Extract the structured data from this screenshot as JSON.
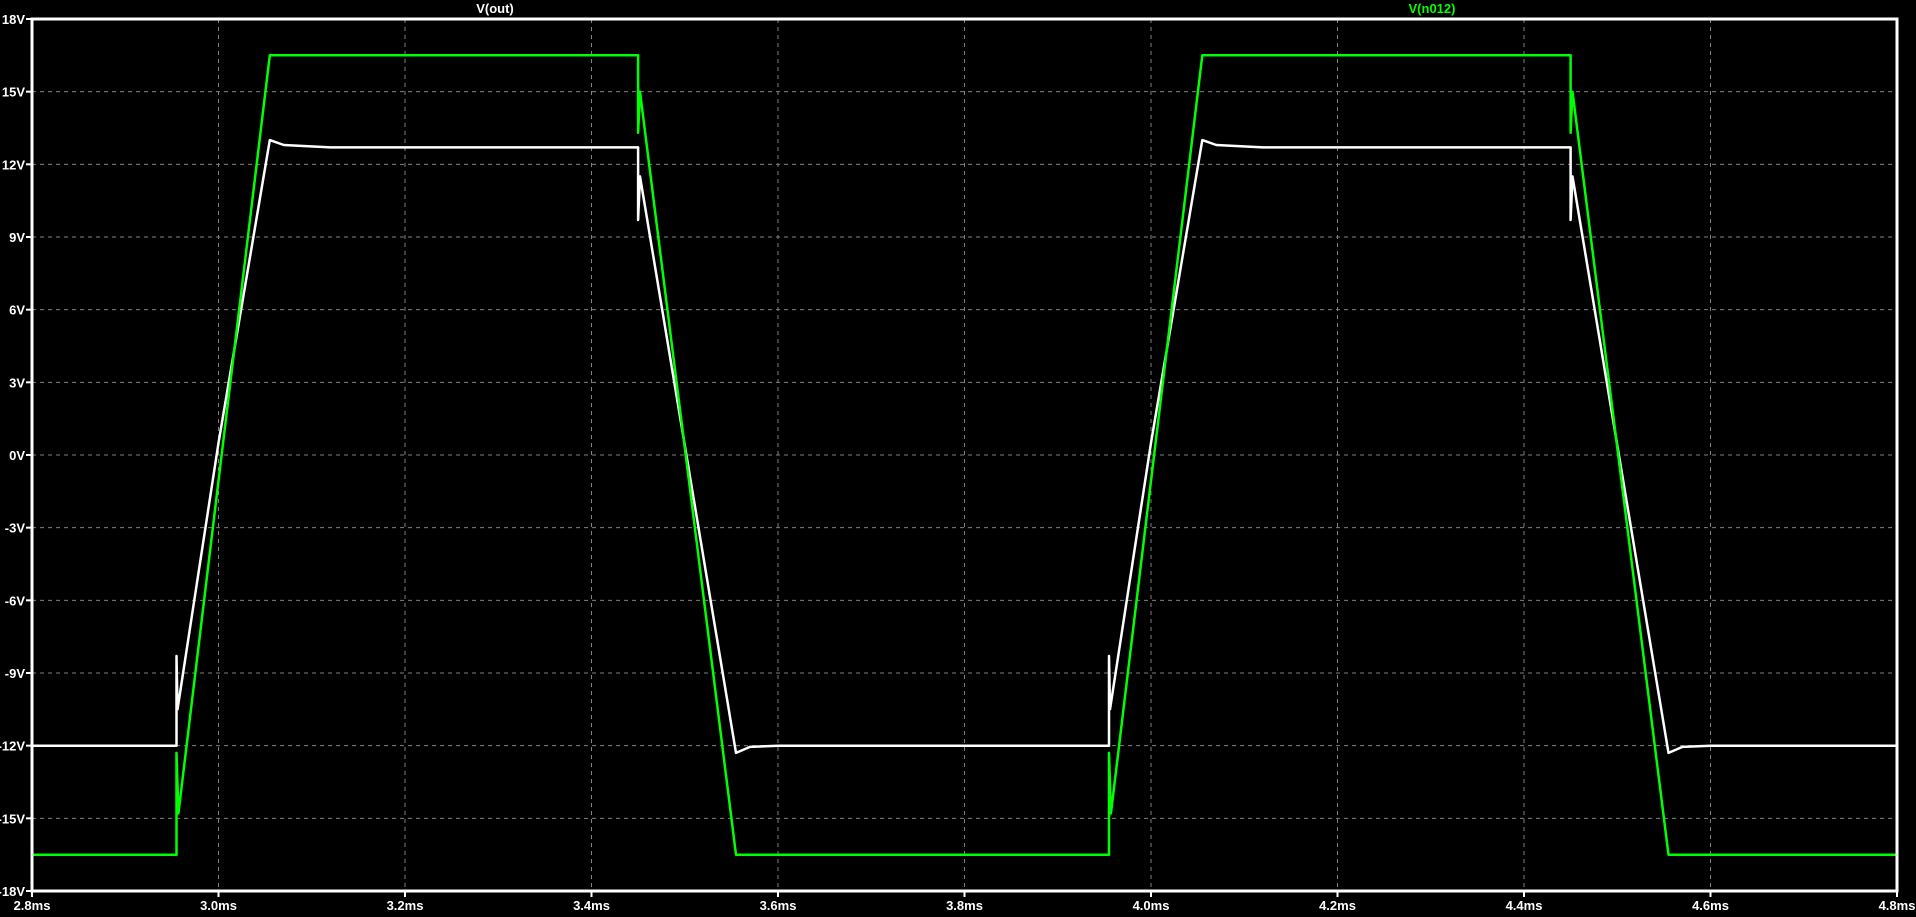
{
  "chart_data": {
    "type": "line",
    "title": "",
    "xlabel": "",
    "ylabel": "",
    "xlim": [
      2.8,
      4.8
    ],
    "ylim": [
      -18,
      18
    ],
    "grid": true,
    "background": "#000000",
    "x_ticks": [
      2.8,
      3.0,
      3.2,
      3.4,
      3.6,
      3.8,
      4.0,
      4.2,
      4.4,
      4.6,
      4.8
    ],
    "x_tick_labels": [
      "2.8ms",
      "3.0ms",
      "3.2ms",
      "3.4ms",
      "3.6ms",
      "3.8ms",
      "4.0ms",
      "4.2ms",
      "4.4ms",
      "4.6ms",
      "4.8ms"
    ],
    "y_ticks": [
      18,
      15,
      12,
      9,
      6,
      3,
      0,
      -3,
      -6,
      -9,
      -12,
      -15,
      -18
    ],
    "y_tick_labels": [
      "18V",
      "15V",
      "12V",
      "9V",
      "6V",
      "3V",
      "0V",
      "-3V",
      "-6V",
      "-9V",
      "-12V",
      "-15V",
      "-18V"
    ],
    "legend_placement": "top",
    "series": [
      {
        "name": "V(out)",
        "color": "#ffffff",
        "points": [
          [
            2.8,
            -12
          ],
          [
            2.955,
            -12
          ],
          [
            2.955,
            -8.3
          ],
          [
            2.956,
            -10.5
          ],
          [
            3.0,
            0.5
          ],
          [
            3.055,
            13.0
          ],
          [
            3.07,
            12.8
          ],
          [
            3.12,
            12.7
          ],
          [
            3.45,
            12.7
          ],
          [
            3.45,
            9.7
          ],
          [
            3.452,
            11.5
          ],
          [
            3.555,
            -12.3
          ],
          [
            3.57,
            -12.05
          ],
          [
            3.6,
            -12
          ],
          [
            3.955,
            -12
          ],
          [
            3.955,
            -8.3
          ],
          [
            3.956,
            -10.5
          ],
          [
            4.0,
            0.5
          ],
          [
            4.055,
            13.0
          ],
          [
            4.07,
            12.8
          ],
          [
            4.12,
            12.7
          ],
          [
            4.45,
            12.7
          ],
          [
            4.45,
            9.7
          ],
          [
            4.452,
            11.5
          ],
          [
            4.555,
            -12.3
          ],
          [
            4.57,
            -12.05
          ],
          [
            4.6,
            -12
          ],
          [
            4.8,
            -12
          ]
        ]
      },
      {
        "name": "V(n012)",
        "color": "#00ff00",
        "points": [
          [
            2.8,
            -16.5
          ],
          [
            2.955,
            -16.5
          ],
          [
            2.955,
            -12.3
          ],
          [
            2.957,
            -14.8
          ],
          [
            3.055,
            16.5
          ],
          [
            3.45,
            16.5
          ],
          [
            3.45,
            13.3
          ],
          [
            3.452,
            15.0
          ],
          [
            3.555,
            -16.5
          ],
          [
            3.955,
            -16.5
          ],
          [
            3.955,
            -12.3
          ],
          [
            3.957,
            -14.8
          ],
          [
            4.055,
            16.5
          ],
          [
            4.45,
            16.5
          ],
          [
            4.45,
            13.3
          ],
          [
            4.452,
            15.0
          ],
          [
            4.555,
            -16.5
          ],
          [
            4.8,
            -16.5
          ]
        ]
      }
    ]
  }
}
